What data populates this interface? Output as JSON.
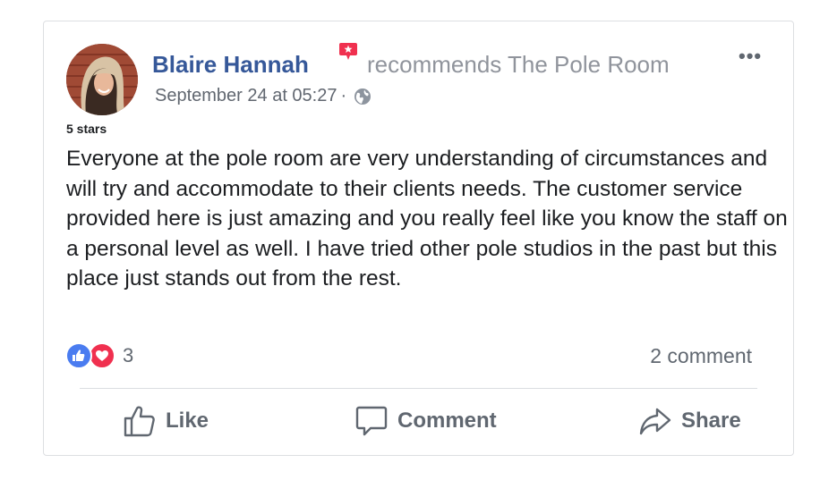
{
  "post": {
    "author": "Blaire Hannah",
    "action_text": "recommends The Pole Room",
    "timestamp": "September 24 at 05:27",
    "separator": "·",
    "privacy_icon": "globe-icon",
    "more_label": "•••",
    "rating": "5 stars",
    "body": "Everyone at the pole room are very understanding of circumstances and will try and accommodate to their clients needs. The customer service provided here is just amazing and you really feel like you know the staff on a personal level as well. I have tried other pole studios in the past but this place just stands out from the rest."
  },
  "reactions": {
    "icons": [
      "like-icon",
      "love-icon"
    ],
    "count": "3",
    "comments": "2 comment"
  },
  "actions": {
    "like": "Like",
    "comment": "Comment",
    "share": "Share"
  },
  "colors": {
    "author": "#365899",
    "like": "#4a7cf0",
    "love": "#f0304f",
    "recommend_badge": "#f0304f",
    "muted": "#90949c"
  }
}
